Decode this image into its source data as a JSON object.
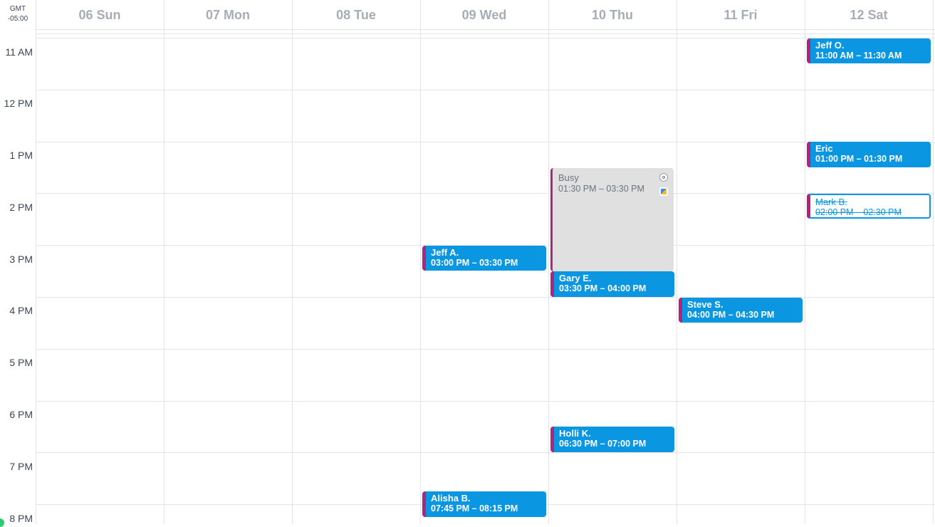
{
  "timezone": {
    "line1": "GMT",
    "line2": "-05:00"
  },
  "days": [
    {
      "label": "06 Sun"
    },
    {
      "label": "07 Mon"
    },
    {
      "label": "08 Tue"
    },
    {
      "label": "09 Wed"
    },
    {
      "label": "10 Thu"
    },
    {
      "label": "11 Fri"
    },
    {
      "label": "12 Sat"
    }
  ],
  "hours": [
    "11 AM",
    "12 PM",
    "1 PM",
    "2 PM",
    "3 PM",
    "4 PM",
    "5 PM",
    "6 PM",
    "7 PM",
    "8 PM"
  ],
  "events": [
    {
      "name": "Jeff O.",
      "time": "11:00 AM – 11:30 AM"
    },
    {
      "name": "Eric",
      "time": "01:00 PM – 01:30 PM"
    },
    {
      "name": "Mark B.",
      "time": "02:00 PM – 02:30 PM"
    },
    {
      "name": "Busy",
      "time": "01:30 PM – 03:30 PM"
    },
    {
      "name": "Jeff A.",
      "time": "03:00 PM – 03:30 PM"
    },
    {
      "name": "Gary E.",
      "time": "03:30 PM – 04:00 PM"
    },
    {
      "name": "Steve S.",
      "time": "04:00 PM – 04:30 PM"
    },
    {
      "name": "Holli K.",
      "time": "06:30 PM – 07:00 PM"
    },
    {
      "name": "Alisha B.",
      "time": "07:45 PM – 08:15 PM"
    }
  ],
  "colors": {
    "event": "#0a96e0",
    "accent": "#b0237e",
    "busy": "#e0e0e0"
  },
  "icons": [
    "settings-icon",
    "google-calendar-icon"
  ]
}
